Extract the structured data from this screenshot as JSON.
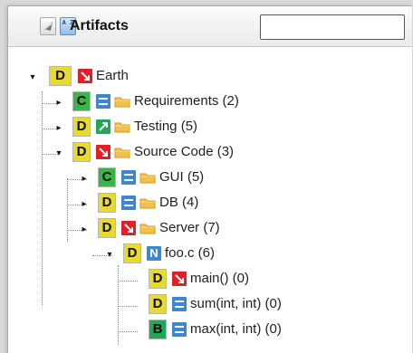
{
  "window": {
    "title": "Artifacts",
    "search": {
      "value": "",
      "placeholder": ""
    }
  },
  "toolbar": {
    "buttons": [
      {
        "icon": "collapse-tree-icon"
      },
      {
        "icon": "sort-az-icon",
        "text": "A Z"
      }
    ]
  },
  "tree": {
    "nodes": [
      {
        "badge": "D",
        "status_icon": "status-down-icon",
        "label": "Earth",
        "expanded": true
      },
      {
        "badge": "C",
        "status_icon": "status-neutral-icon",
        "label": "Requirements (2)",
        "expanded": false
      },
      {
        "badge": "D",
        "status_icon": "status-up-icon",
        "label": "Testing (5)",
        "expanded": false
      },
      {
        "badge": "D",
        "status_icon": "status-down-icon",
        "label": "Source Code (3)",
        "expanded": true
      },
      {
        "badge": "C",
        "status_icon": "status-neutral-icon",
        "label": "GUI (5)",
        "expanded": false
      },
      {
        "badge": "D",
        "status_icon": "status-neutral-icon",
        "label": "DB (4)",
        "expanded": false
      },
      {
        "badge": "D",
        "status_icon": "status-down-icon",
        "label": "Server (7)",
        "expanded": false
      },
      {
        "badge": "D",
        "status_icon": "file-n-icon",
        "status_text": "N",
        "label": "foo.c (6)",
        "expanded": true
      },
      {
        "badge": "D",
        "status_icon": "status-down-icon",
        "label": "main() (0)"
      },
      {
        "badge": "D",
        "status_icon": "status-neutral-icon",
        "label": "sum(int, int) (0)"
      },
      {
        "badge": "B",
        "status_icon": "status-neutral-icon",
        "label": "max(int, int) (0)"
      }
    ]
  },
  "colors": {
    "grade_D": "#e8da2f",
    "grade_C": "#39b54a",
    "grade_B": "#21a65a",
    "status_red": "#e01f26",
    "status_green": "#21a65a",
    "status_blue": "#3d86d1",
    "folder": "#f0c14b"
  }
}
